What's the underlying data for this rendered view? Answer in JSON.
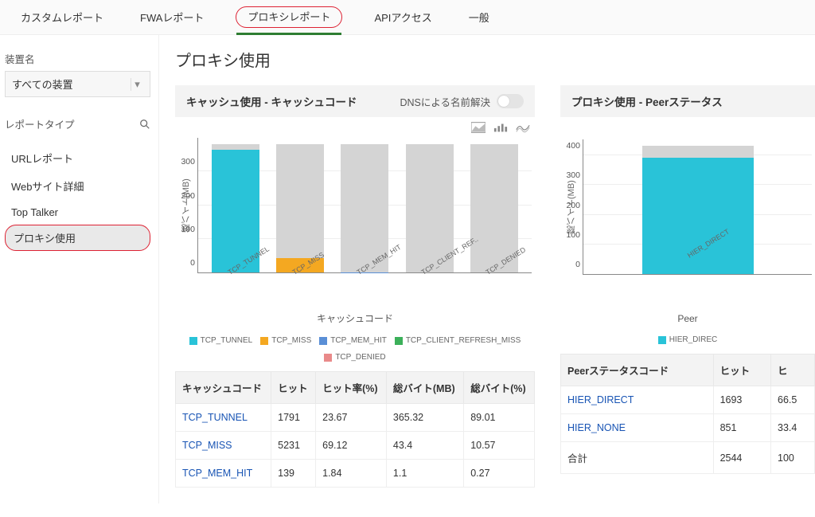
{
  "topnav": {
    "tabs": [
      "カスタムレポート",
      "FWAレポート",
      "プロキシレポート",
      "APIアクセス",
      "一般"
    ],
    "active_index": 2
  },
  "sidebar": {
    "device_label": "装置名",
    "device_select_value": "すべての装置",
    "report_type_label": "レポートタイプ",
    "items": [
      "URLレポート",
      "Webサイト詳細",
      "Top Talker",
      "プロキシ使用"
    ],
    "selected_index": 3
  },
  "page_title": "プロキシ使用",
  "cache_panel": {
    "title": "キャッシュ使用 - キャッシュコード",
    "dns_label": "DNSによる名前解決",
    "ylabel": "総バイト(MB)",
    "xlabel": "キャッシュコード",
    "table_headers": [
      "キャッシュコード",
      "ヒット",
      "ヒット率(%)",
      "総バイト(MB)",
      "総バイト(%)"
    ],
    "rows": [
      {
        "code": "TCP_TUNNEL",
        "hit": "1791",
        "hit_pct": "23.67",
        "mb": "365.32",
        "mb_pct": "89.01"
      },
      {
        "code": "TCP_MISS",
        "hit": "5231",
        "hit_pct": "69.12",
        "mb": "43.4",
        "mb_pct": "10.57"
      },
      {
        "code": "TCP_MEM_HIT",
        "hit": "139",
        "hit_pct": "1.84",
        "mb": "1.1",
        "mb_pct": "0.27"
      }
    ]
  },
  "peer_panel": {
    "title": "プロキシ使用 - Peerステータス",
    "ylabel": "総バイト(MB)",
    "xlabel": "Peer",
    "table_headers": [
      "Peerステータスコード",
      "ヒット",
      "ヒ"
    ],
    "rows": [
      {
        "code": "HIER_DIRECT",
        "hit": "1693",
        "pct": "66.5"
      },
      {
        "code": "HIER_NONE",
        "hit": "851",
        "pct": "33.4"
      }
    ],
    "total_label": "合計",
    "total_hit": "2544",
    "total_pct": "100"
  },
  "colors": {
    "TCP_TUNNEL": "#29c3d8",
    "TCP_MISS": "#f4a821",
    "TCP_MEM_HIT": "#5a8fd6",
    "TCP_CLIENT_REFRESH_MISS": "#3cb05a",
    "TCP_DENIED": "#e98a8a",
    "HIER_DIRECT": "#29c3d8"
  },
  "chart_data": [
    {
      "type": "bar",
      "title": "キャッシュ使用 - キャッシュコード",
      "xlabel": "キャッシュコード",
      "ylabel": "総バイト(MB)",
      "ylim": [
        0,
        400
      ],
      "yticks": [
        0,
        100,
        200,
        300
      ],
      "categories": [
        "TCP_TUNNEL",
        "TCP_MISS",
        "TCP_MEM_HIT",
        "TCP_CLIENT_REF..",
        "TCP_DENIED"
      ],
      "values": [
        365,
        43,
        1,
        0,
        0
      ],
      "legend": [
        "TCP_TUNNEL",
        "TCP_MISS",
        "TCP_MEM_HIT",
        "TCP_CLIENT_REFRESH_MISS",
        "TCP_DENIED"
      ]
    },
    {
      "type": "bar",
      "title": "プロキシ使用 - Peerステータス",
      "xlabel": "Peer",
      "ylabel": "総バイト(MB)",
      "ylim": [
        0,
        450
      ],
      "yticks": [
        0,
        100,
        200,
        300,
        400
      ],
      "categories": [
        "HIER_DIRECT"
      ],
      "values": [
        390
      ],
      "legend": [
        "HIER_DIREC"
      ]
    }
  ]
}
